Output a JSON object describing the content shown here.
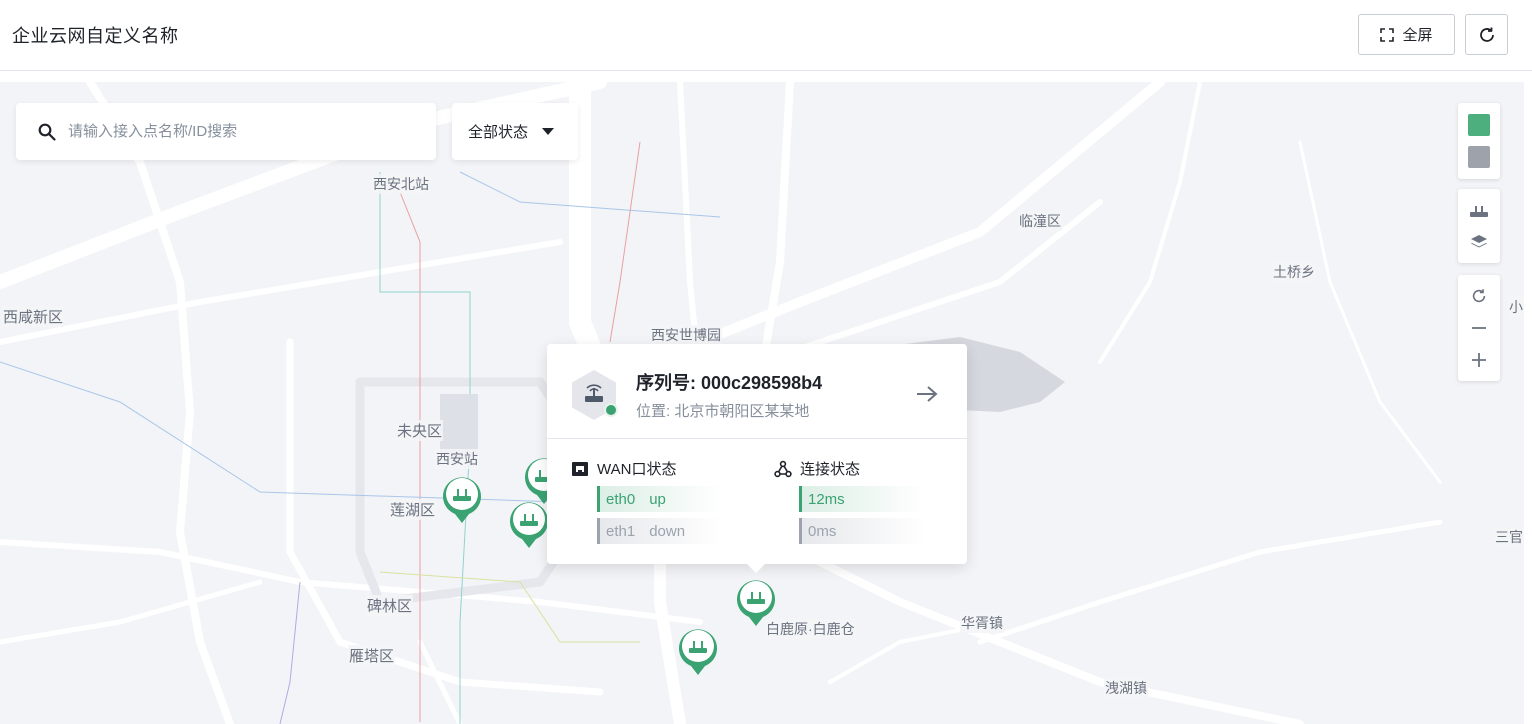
{
  "header": {
    "title": "企业云网自定义名称",
    "fullscreen_label": "全屏"
  },
  "search": {
    "placeholder": "请输入接入点名称/ID搜索",
    "status_filter": "全部状态"
  },
  "map_places": [
    {
      "name": "西安北站"
    },
    {
      "name": "临潼区"
    },
    {
      "name": "土桥乡"
    },
    {
      "name": "西咸新区"
    },
    {
      "name": "西安世博园"
    },
    {
      "name": "未央区"
    },
    {
      "name": "西安站"
    },
    {
      "name": "莲湖区"
    },
    {
      "name": "碑林区"
    },
    {
      "name": "雁塔区"
    },
    {
      "name": "白鹿原·白鹿仓"
    },
    {
      "name": "华胥镇"
    },
    {
      "name": "洩湖镇"
    },
    {
      "name": "三官"
    },
    {
      "name": "小"
    }
  ],
  "legend": {
    "online_color": "#4caf7d",
    "offline_color": "#9ea3ab"
  },
  "map_controls": [
    "router-icon",
    "layers-icon",
    "reset-icon",
    "zoom-out-icon",
    "zoom-in-icon"
  ],
  "popup": {
    "serial": "序列号: 000c298598b4",
    "location": "位置: 北京市朝阳区某某地",
    "wan_title": "WAN口状态",
    "conn_title": "连接状态",
    "wan_rows": [
      {
        "port": "eth0",
        "state": "up"
      },
      {
        "port": "eth1",
        "state": "down"
      }
    ],
    "conn_rows": [
      "12ms",
      "0ms"
    ]
  }
}
